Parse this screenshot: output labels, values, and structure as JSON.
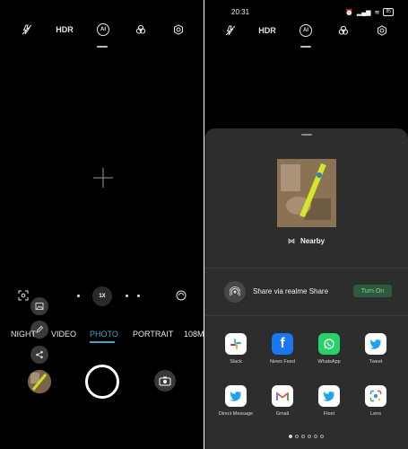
{
  "left_screen": {
    "toolbar": {
      "flash_icon": "flash-off-icon",
      "hdr_label": "HDR",
      "ai_label": "AI",
      "filter_icon": "filter-circles-icon",
      "settings_icon": "gear-icon"
    },
    "zoom": {
      "label": "1X"
    },
    "modes": [
      "NIGHT",
      "VIDEO",
      "PHOTO",
      "PORTRAIT",
      "108M"
    ],
    "active_mode": "PHOTO",
    "popup_icons": [
      "image-frame-icon",
      "edit-icon",
      "share-icon"
    ]
  },
  "right_screen": {
    "status_bar": {
      "time": "20:31",
      "battery": "85"
    },
    "toolbar": {
      "hdr_label": "HDR",
      "ai_label": "AI"
    },
    "share_sheet": {
      "nearby_label": "Nearby",
      "realme_share_label": "Share via realme Share",
      "turn_on_label": "Turn On",
      "apps": [
        {
          "label": "Slack",
          "icon": "slack-icon",
          "color": "#ffffff"
        },
        {
          "label": "News Feed",
          "icon": "facebook-icon",
          "color": "#1877f2"
        },
        {
          "label": "WhatsApp",
          "icon": "whatsapp-icon",
          "color": "#25d366"
        },
        {
          "label": "Tweet",
          "icon": "twitter-icon",
          "color": "#ffffff"
        },
        {
          "label": "Direct Message",
          "icon": "twitter-icon",
          "color": "#ffffff"
        },
        {
          "label": "Gmail",
          "icon": "gmail-icon",
          "color": "#ffffff"
        },
        {
          "label": "Fleet",
          "icon": "twitter-icon",
          "color": "#ffffff"
        },
        {
          "label": "Lens",
          "icon": "google-lens-icon",
          "color": "#ffffff"
        }
      ],
      "pages": 6,
      "current_page": 1
    }
  },
  "colors": {
    "accent": "#39a7c9",
    "turn_on_bg": "#2f5a3e",
    "turn_on_text": "#77d48e",
    "sheet_bg": "#2d2d2d"
  }
}
